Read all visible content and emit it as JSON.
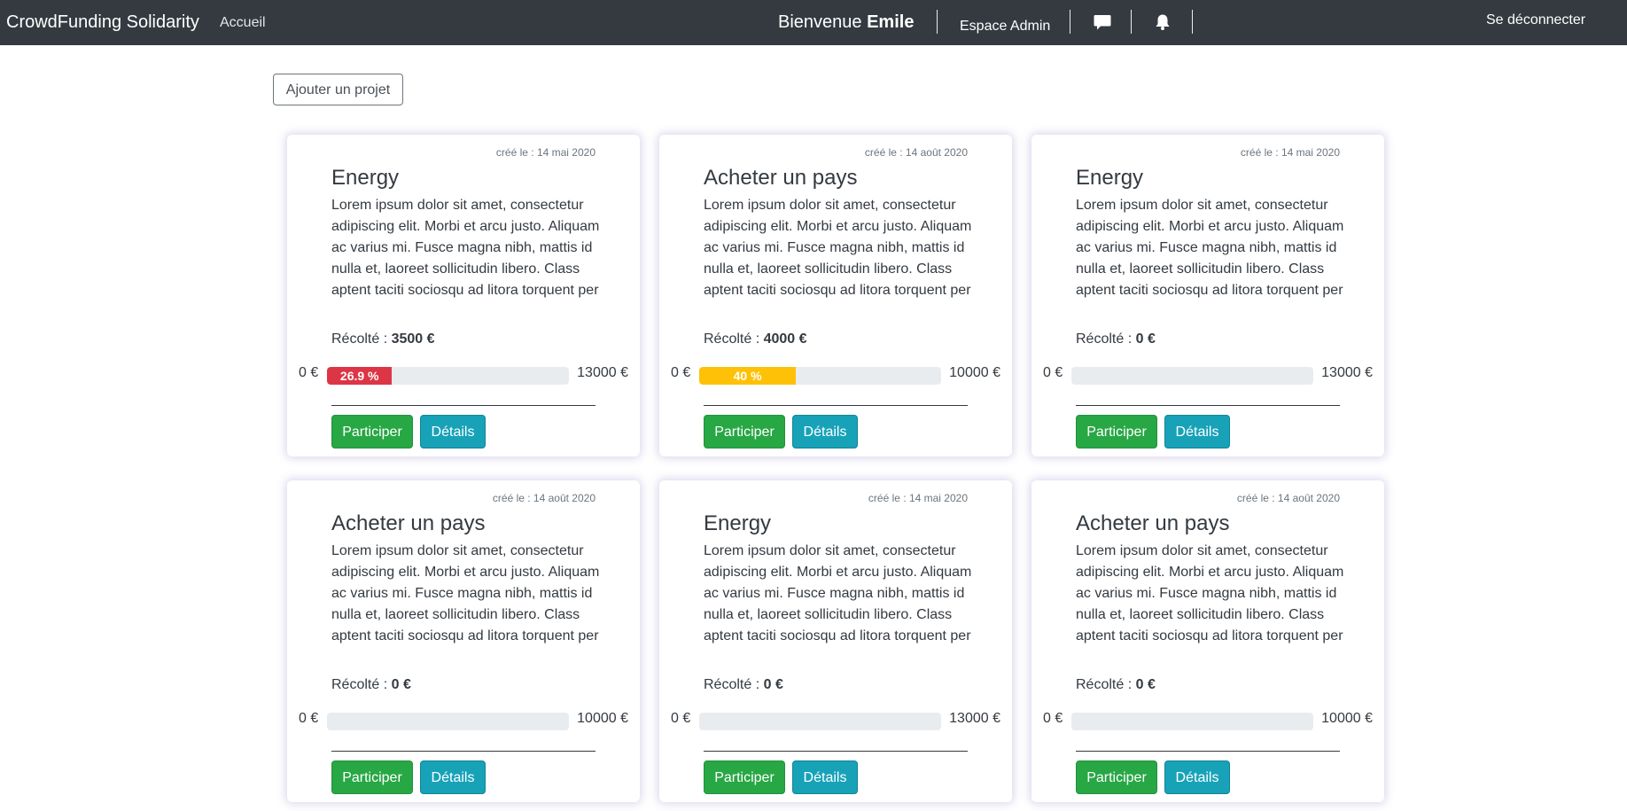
{
  "navbar": {
    "brand": "CrowdFunding Solidarity",
    "home": "Accueil",
    "welcome_prefix": "Bienvenue ",
    "user_name": "Emile",
    "admin": "Espace Admin",
    "message_icon": "chat-bubble-icon",
    "notification_icon": "bell-icon",
    "logout": "Se déconnecter"
  },
  "actions": {
    "add_project": "Ajouter un projet"
  },
  "colors": {
    "navbar_bg": "#343a40",
    "success": "#28a745",
    "info": "#17a2b8",
    "danger": "#dc3545",
    "warning": "#ffc107",
    "track": "#e9ecef"
  },
  "projects": [
    {
      "date": "créé le : 14 mai 2020",
      "title": "Energy",
      "description": "Lorem ipsum dolor sit amet, consectetur adipiscing elit. Morbi et arcu justo. Aliquam ac varius mi. Fusce magna nibh, mattis id nulla et, laoreet sollicitudin libero. Class aptent taciti sociosqu ad litora torquent per conubia nostra, per",
      "raised_label": "Récolté : ",
      "raised": "3500 €",
      "min": "0 €",
      "max": "13000 €",
      "progress_label": "26.9 %",
      "progress": 26.9,
      "progress_color": "#dc3545",
      "participate": "Participer",
      "details": "Détails"
    },
    {
      "date": "créé le : 14 août 2020",
      "title": "Acheter un pays",
      "description": "Lorem ipsum dolor sit amet, consectetur adipiscing elit. Morbi et arcu justo. Aliquam ac varius mi. Fusce magna nibh, mattis id nulla et, laoreet sollicitudin libero. Class aptent taciti sociosqu ad litora torquent per conubia nostra, per",
      "raised_label": "Récolté : ",
      "raised": "4000 €",
      "min": "0 €",
      "max": "10000 €",
      "progress_label": "40 %",
      "progress": 40,
      "progress_color": "#ffc107",
      "participate": "Participer",
      "details": "Détails"
    },
    {
      "date": "créé le : 14 mai 2020",
      "title": "Energy",
      "description": "Lorem ipsum dolor sit amet, consectetur adipiscing elit. Morbi et arcu justo. Aliquam ac varius mi. Fusce magna nibh, mattis id nulla et, laoreet sollicitudin libero. Class aptent taciti sociosqu ad litora torquent per conubia nostra, per",
      "raised_label": "Récolté : ",
      "raised": "0 €",
      "min": "0 €",
      "max": "13000 €",
      "progress_label": "",
      "progress": 0,
      "progress_color": "#dc3545",
      "participate": "Participer",
      "details": "Détails"
    },
    {
      "date": "créé le : 14 août 2020",
      "title": "Acheter un pays",
      "description": "Lorem ipsum dolor sit amet, consectetur adipiscing elit. Morbi et arcu justo. Aliquam ac varius mi. Fusce magna nibh, mattis id nulla et, laoreet sollicitudin libero. Class aptent taciti sociosqu ad litora torquent per conubia nostra, per",
      "raised_label": "Récolté : ",
      "raised": "0 €",
      "min": "0 €",
      "max": "10000 €",
      "progress_label": "",
      "progress": 0,
      "progress_color": "#dc3545",
      "participate": "Participer",
      "details": "Détails"
    },
    {
      "date": "créé le : 14 mai 2020",
      "title": "Energy",
      "description": "Lorem ipsum dolor sit amet, consectetur adipiscing elit. Morbi et arcu justo. Aliquam ac varius mi. Fusce magna nibh, mattis id nulla et, laoreet sollicitudin libero. Class aptent taciti sociosqu ad litora torquent per conubia nostra, per",
      "raised_label": "Récolté : ",
      "raised": "0 €",
      "min": "0 €",
      "max": "13000 €",
      "progress_label": "",
      "progress": 0,
      "progress_color": "#dc3545",
      "participate": "Participer",
      "details": "Détails"
    },
    {
      "date": "créé le : 14 août 2020",
      "title": "Acheter un pays",
      "description": "Lorem ipsum dolor sit amet, consectetur adipiscing elit. Morbi et arcu justo. Aliquam ac varius mi. Fusce magna nibh, mattis id nulla et, laoreet sollicitudin libero. Class aptent taciti sociosqu ad litora torquent per conubia nostra, per",
      "raised_label": "Récolté : ",
      "raised": "0 €",
      "min": "0 €",
      "max": "10000 €",
      "progress_label": "",
      "progress": 0,
      "progress_color": "#dc3545",
      "participate": "Participer",
      "details": "Détails"
    }
  ]
}
